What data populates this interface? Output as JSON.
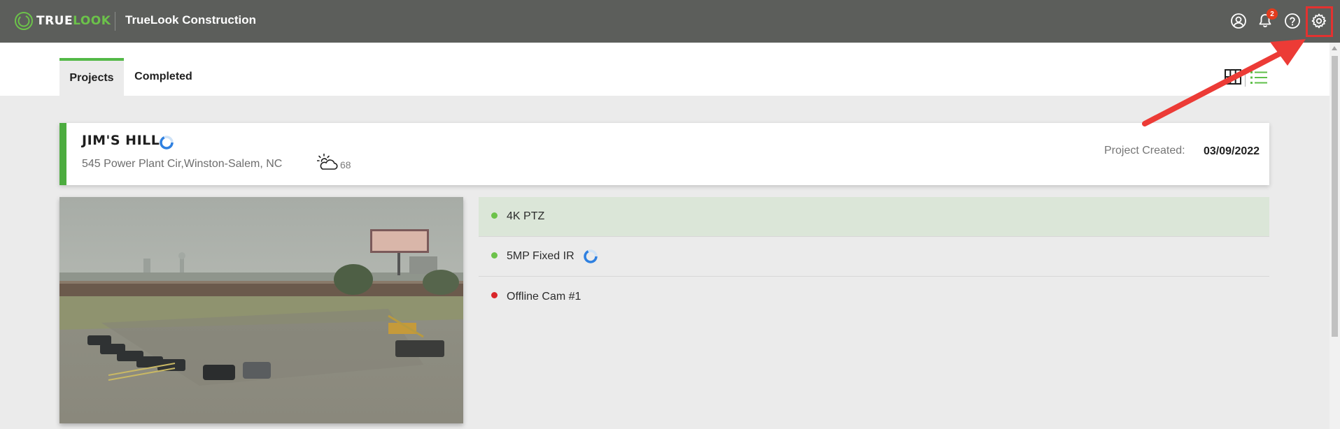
{
  "header": {
    "logo_part1": "TRUE",
    "logo_part2": "LOOK",
    "company": "TrueLook Construction",
    "notification_count": "2",
    "icons": [
      "user-icon",
      "bell-icon",
      "help-icon",
      "gear-icon"
    ]
  },
  "tabs": [
    {
      "label": "Projects",
      "active": true
    },
    {
      "label": "Completed",
      "active": false
    }
  ],
  "view_toggle": {
    "grid": "grid-view-icon",
    "list": "list-view-icon",
    "selected": "list"
  },
  "project": {
    "name": "JIM'S HILL",
    "address": "545 Power Plant Cir,Winston-Salem, NC",
    "weather_icon": "partly-cloudy-icon",
    "temperature": "68",
    "created_label": "Project Created:",
    "created_date": "03/09/2022",
    "accent_color": "#4cac3f"
  },
  "cameras": [
    {
      "name": "4K PTZ",
      "status": "online",
      "status_color": "#6cc24a",
      "processing": false
    },
    {
      "name": "5MP Fixed IR",
      "status": "online",
      "status_color": "#6cc24a",
      "processing": true
    },
    {
      "name": "Offline Cam #1",
      "status": "offline",
      "status_color": "#d9262a",
      "processing": false
    }
  ],
  "colors": {
    "topbar": "#5c5e5b",
    "brand_green": "#6cc24a",
    "annotation_red": "#e33230"
  }
}
